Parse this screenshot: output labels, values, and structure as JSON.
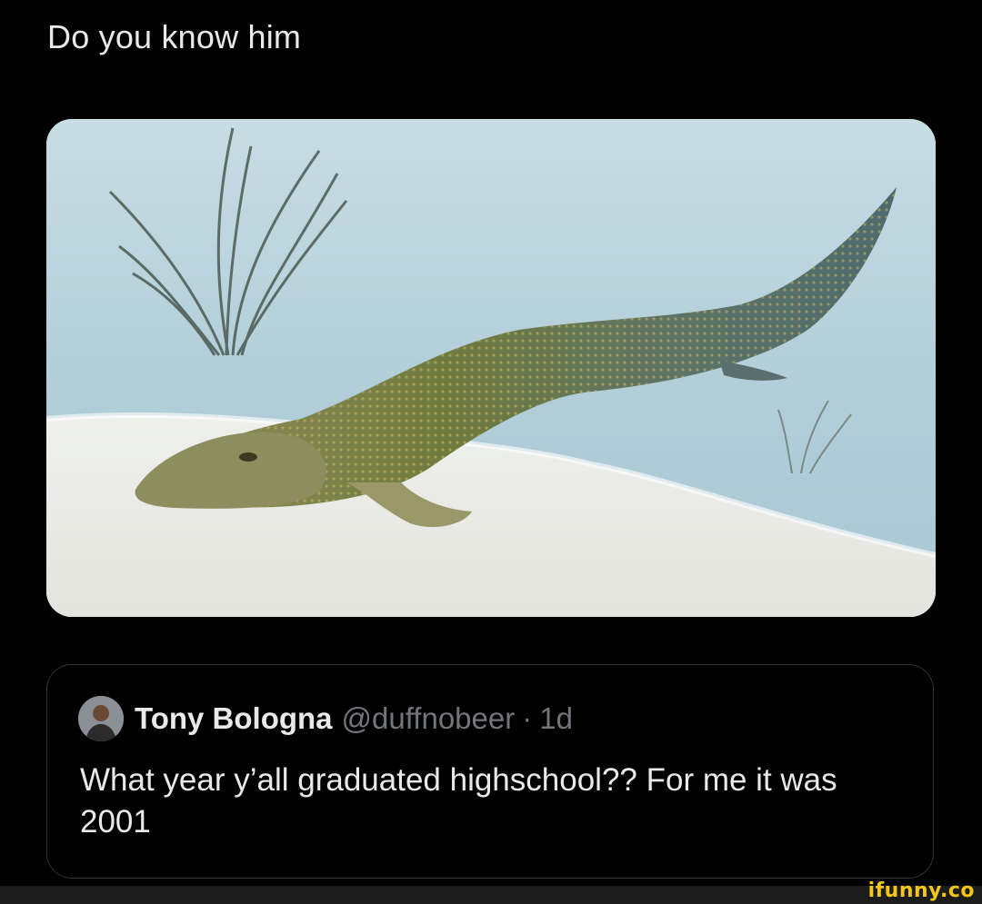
{
  "tweet": {
    "text": "Do you know him"
  },
  "media": {
    "icon": "fish-tetrapod-illustration"
  },
  "quote": {
    "display_name": "Tony Bologna",
    "handle": "@duffnobeer",
    "separator": "·",
    "time": "1d",
    "body": "What year y’all graduated highschool?? For me it was 2001",
    "avatar_icon": "user-avatar"
  },
  "watermark": {
    "text": "ifunny.co"
  },
  "colors": {
    "background": "#000000",
    "primary_text": "#e7e9ea",
    "secondary_text": "#71767b",
    "border": "#2f3336",
    "watermark": "#f5c518"
  }
}
